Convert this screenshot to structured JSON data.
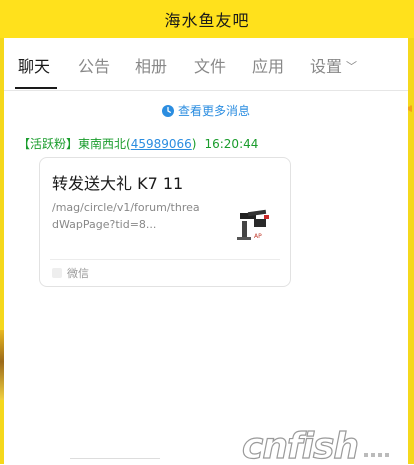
{
  "window": {
    "title": "海水鱼友吧"
  },
  "tabs": [
    {
      "label": "聊天",
      "active": true
    },
    {
      "label": "公告",
      "active": false
    },
    {
      "label": "相册",
      "active": false
    },
    {
      "label": "文件",
      "active": false
    },
    {
      "label": "应用",
      "active": false
    },
    {
      "label": "设置",
      "active": false
    }
  ],
  "chat": {
    "more_messages": "查看更多消息",
    "message": {
      "badge": "【活跃粉】",
      "sender_name": "東南西北",
      "paren_open": "(",
      "qq": "45989066",
      "paren_close": ")",
      "time": "16:20:44",
      "card": {
        "title": "转发送大礼 K7 11",
        "description": "/mag/circle/v1/forum/threadWapPage?tid=8...",
        "source": "微信"
      }
    }
  },
  "colors": {
    "titlebar": "#ffe11c",
    "link": "#2b8de0",
    "sender": "#1a9c2c"
  },
  "icons": {
    "clock": "clock-icon",
    "chevron": "chevron-down-icon",
    "phone": "phone-icon",
    "source": "wechat-icon"
  }
}
